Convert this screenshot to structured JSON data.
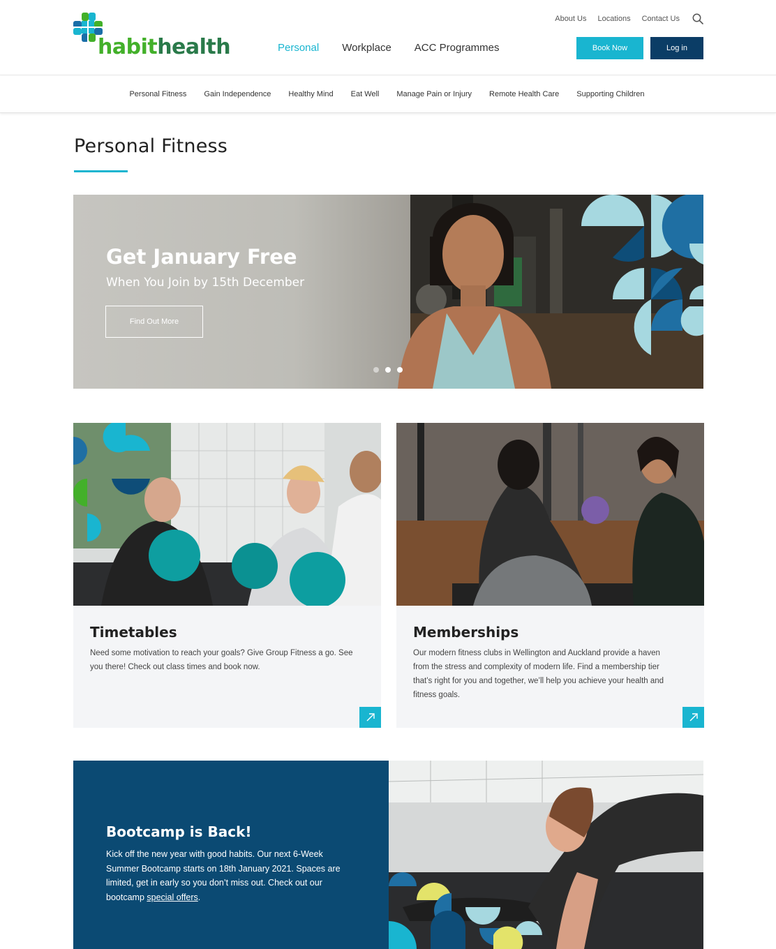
{
  "brand": {
    "name_part1": "habit",
    "name_part2": "health"
  },
  "utility_nav": {
    "about": "About Us",
    "locations": "Locations",
    "contact": "Contact Us"
  },
  "main_nav": [
    {
      "label": "Personal",
      "active": true
    },
    {
      "label": "Workplace",
      "active": false
    },
    {
      "label": "ACC Programmes",
      "active": false
    }
  ],
  "buttons": {
    "book_now": "Book Now",
    "login": "Log in"
  },
  "subnav": [
    "Personal Fitness",
    "Gain Independence",
    "Healthy Mind",
    "Eat Well",
    "Manage Pain or Injury",
    "Remote Health Care",
    "Supporting Children"
  ],
  "page": {
    "title": "Personal Fitness"
  },
  "hero": {
    "title": "Get January Free",
    "subtitle": "When You Join by 15th December",
    "cta": "Find Out More",
    "slide_count": 3,
    "active_slide": 2
  },
  "cards": [
    {
      "title": "Timetables",
      "text": "Need some motivation to reach your goals? Give Group Fitness a go. See you there! Check out class times and book now."
    },
    {
      "title": "Memberships",
      "text": "Our modern fitness clubs in Wellington and Auckland provide a haven from the stress and complexity of modern life. Find a membership tier that’s right for you and together, we’ll help you achieve your health and fitness goals."
    }
  ],
  "bootcamp": {
    "title": "Bootcamp is Back!",
    "text": "Kick off the new year with good habits. Our next 6-Week Summer Bootcamp starts on 18th January 2021. Spaces are limited, get in early so you don’t miss out. Check out our bootcamp ",
    "link": "special offers",
    "end": "."
  },
  "colors": {
    "accent": "#19b5d0",
    "navy": "#0b3d66",
    "brand_green": "#43b02a",
    "card_bg": "#f4f5f7"
  }
}
